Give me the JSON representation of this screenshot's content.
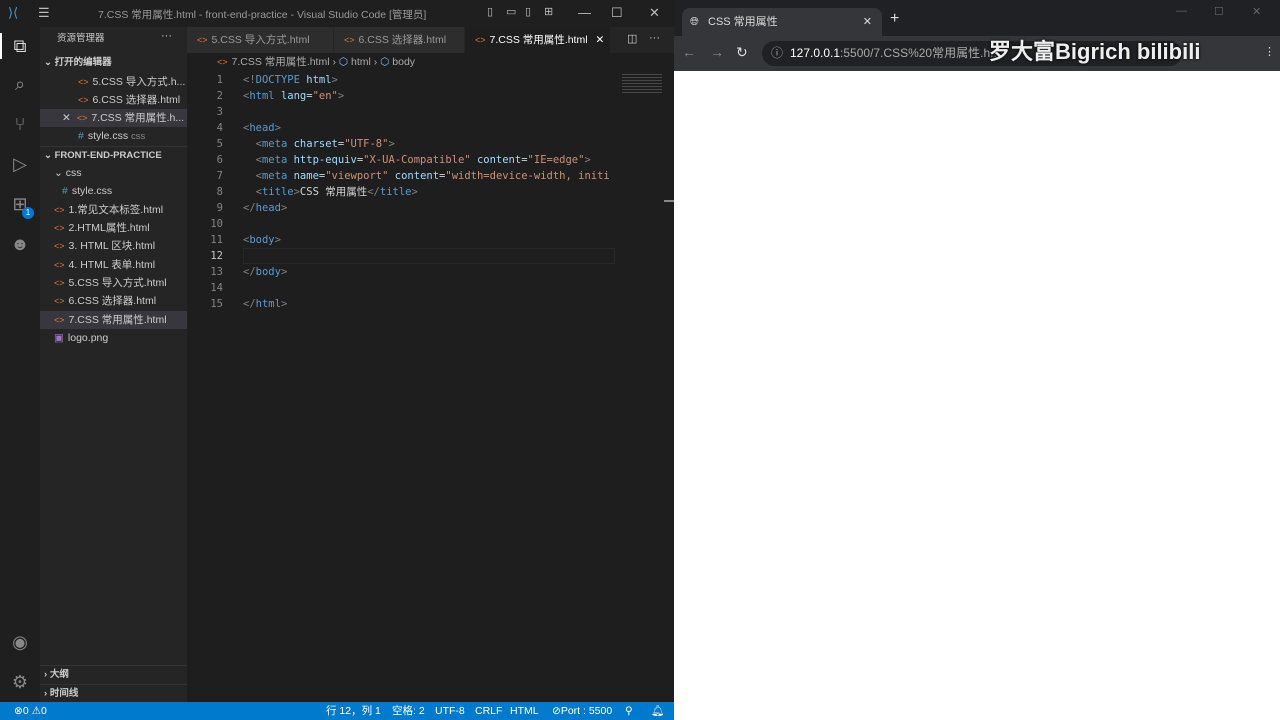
{
  "vscode": {
    "title": "7.CSS 常用属性.html - front-end-practice - Visual Studio Code [管理员]",
    "sidebar": {
      "title": "资源管理器",
      "open_editors_header": "打开的编辑器",
      "open_editors": [
        "5.CSS 导入方式.h...",
        "6.CSS 选择器.html",
        "7.CSS 常用属性.h...",
        "style.css"
      ],
      "open_editor_hint": "css",
      "project_header": "FRONT-END-PRACTICE",
      "folder": "css",
      "folder_files": [
        "style.css"
      ],
      "files": [
        "1.常见文本标签.html",
        "2.HTML属性.html",
        "3. HTML 区块.html",
        "4. HTML 表单.html",
        "5.CSS 导入方式.html",
        "6.CSS 选择器.html",
        "7.CSS 常用属性.html",
        "logo.png"
      ],
      "outline": "大纲",
      "timeline": "时间线",
      "extensions_badge": "1"
    },
    "tabs": [
      "5.CSS 导入方式.html",
      "6.CSS 选择器.html",
      "7.CSS 常用属性.html"
    ],
    "breadcrumb": [
      "7.CSS 常用属性.html",
      "html",
      "body"
    ],
    "code": {
      "l1": [
        "<!",
        "DOCTYPE",
        " html",
        ">"
      ],
      "l8_text": "CSS 常用属性",
      "l7_content": "width=device-width, initi"
    },
    "status": {
      "errors": "0",
      "warnings": "0",
      "position": "行 12，列 1",
      "spaces": "空格: 2",
      "encoding": "UTF-8",
      "eol": "CRLF",
      "language": "HTML",
      "port": "Port : 5500"
    }
  },
  "browser": {
    "tab_title": "CSS 常用属性",
    "url_host": "127.0.0.1",
    "url_rest": ":5500/7.CSS%20常用属性.h...",
    "watermark": "罗大富Bigrich bilibili"
  }
}
